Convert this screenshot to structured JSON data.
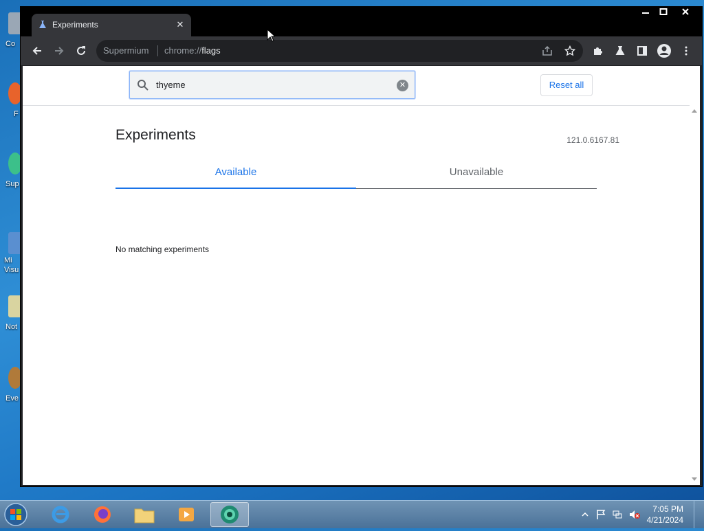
{
  "desktop": {
    "icons": [
      {
        "label": "Co",
        "color": "#9aa7b5"
      },
      {
        "label": "F",
        "color": "#e8632b"
      },
      {
        "label": "Sup",
        "color": "#3cc08a"
      },
      {
        "label": "Mi\nVisu",
        "color": "#5a8fd0"
      },
      {
        "label": "Not",
        "color": "#d9d4a0"
      },
      {
        "label": "Eve",
        "color": "#b07a3a"
      }
    ]
  },
  "browser": {
    "tab_title": "Experiments",
    "omnibox_site": "Supermium",
    "omnibox_url_prefix": "chrome://",
    "omnibox_url_path": "flags",
    "window_controls": {
      "minimize": "—",
      "maximize": "☐",
      "close": "✕"
    }
  },
  "flags_page": {
    "search_value": "thyeme",
    "reset_label": "Reset all",
    "heading": "Experiments",
    "version": "121.0.6167.81",
    "tabs": [
      {
        "label": "Available",
        "active": true
      },
      {
        "label": "Unavailable",
        "active": false
      }
    ],
    "empty_message": "No matching experiments"
  },
  "taskbar": {
    "clock_time": "7:05 PM",
    "clock_date": "4/21/2024",
    "pinned": [
      "internet-explorer",
      "firefox",
      "file-explorer",
      "media-player",
      "supermium"
    ]
  },
  "colors": {
    "accent": "#1a73e8",
    "browser_frame": "#000000",
    "toolbar": "#35363a"
  }
}
